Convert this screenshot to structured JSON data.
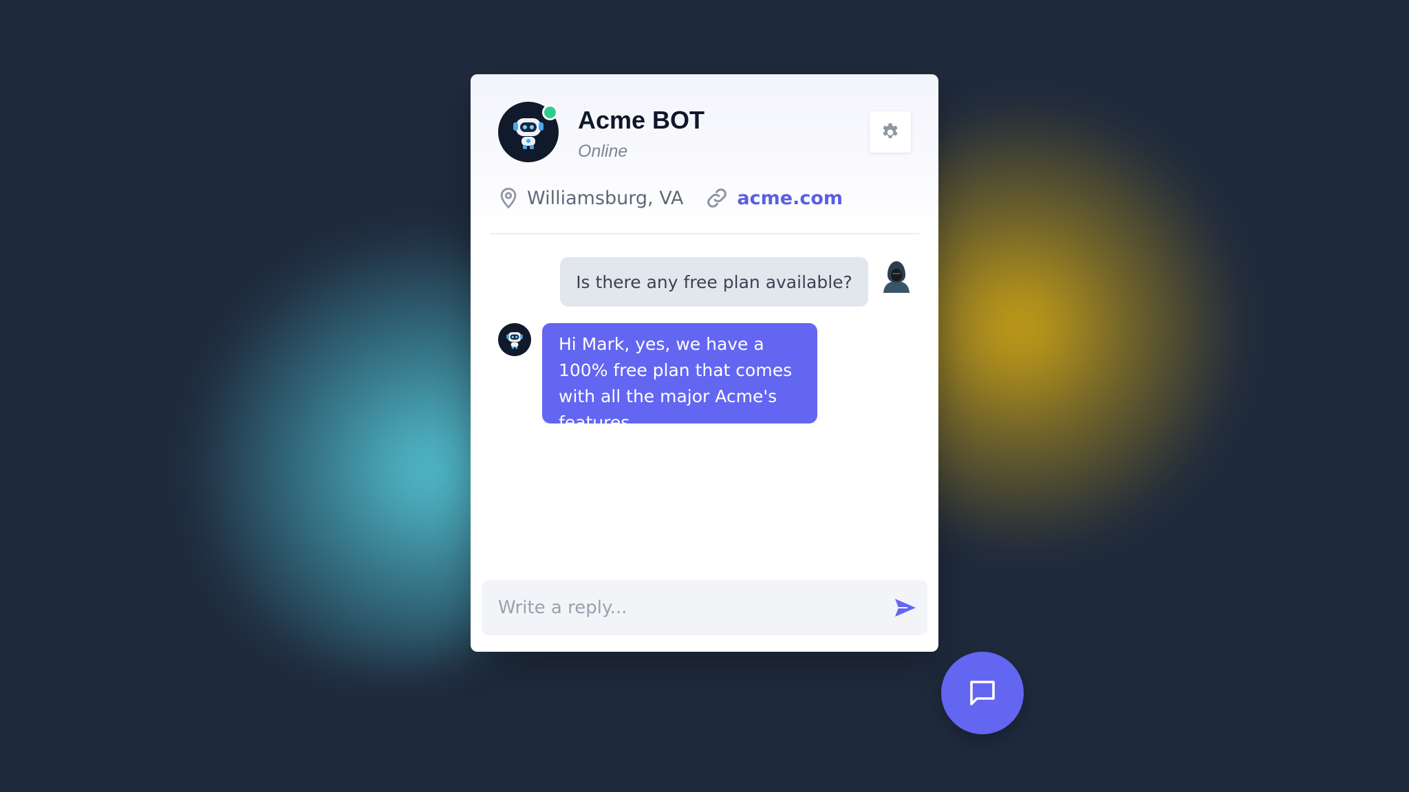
{
  "bot": {
    "name": "Acme BOT",
    "status": "Online",
    "location": "Williamsburg, VA",
    "website": "acme.com"
  },
  "conversation": [
    {
      "from": "user",
      "text": "Is there any free plan available?"
    },
    {
      "from": "bot",
      "text": "Hi Mark, yes, we have a 100% free plan that comes with all the major Acme's features."
    }
  ],
  "composer": {
    "placeholder": "Write a reply...",
    "value": ""
  },
  "icons": {
    "settings": "gear-icon",
    "location": "map-pin-icon",
    "website": "link-icon",
    "send": "send-icon",
    "launcher": "chat-bubble-icon"
  },
  "colors": {
    "accent": "#6366f1",
    "online": "#2ecc8f",
    "background": "#1f2a3c",
    "user_bubble": "#e2e7ee",
    "glow_cyan": "#56c8d6",
    "glow_yellow": "#d6aa14"
  }
}
